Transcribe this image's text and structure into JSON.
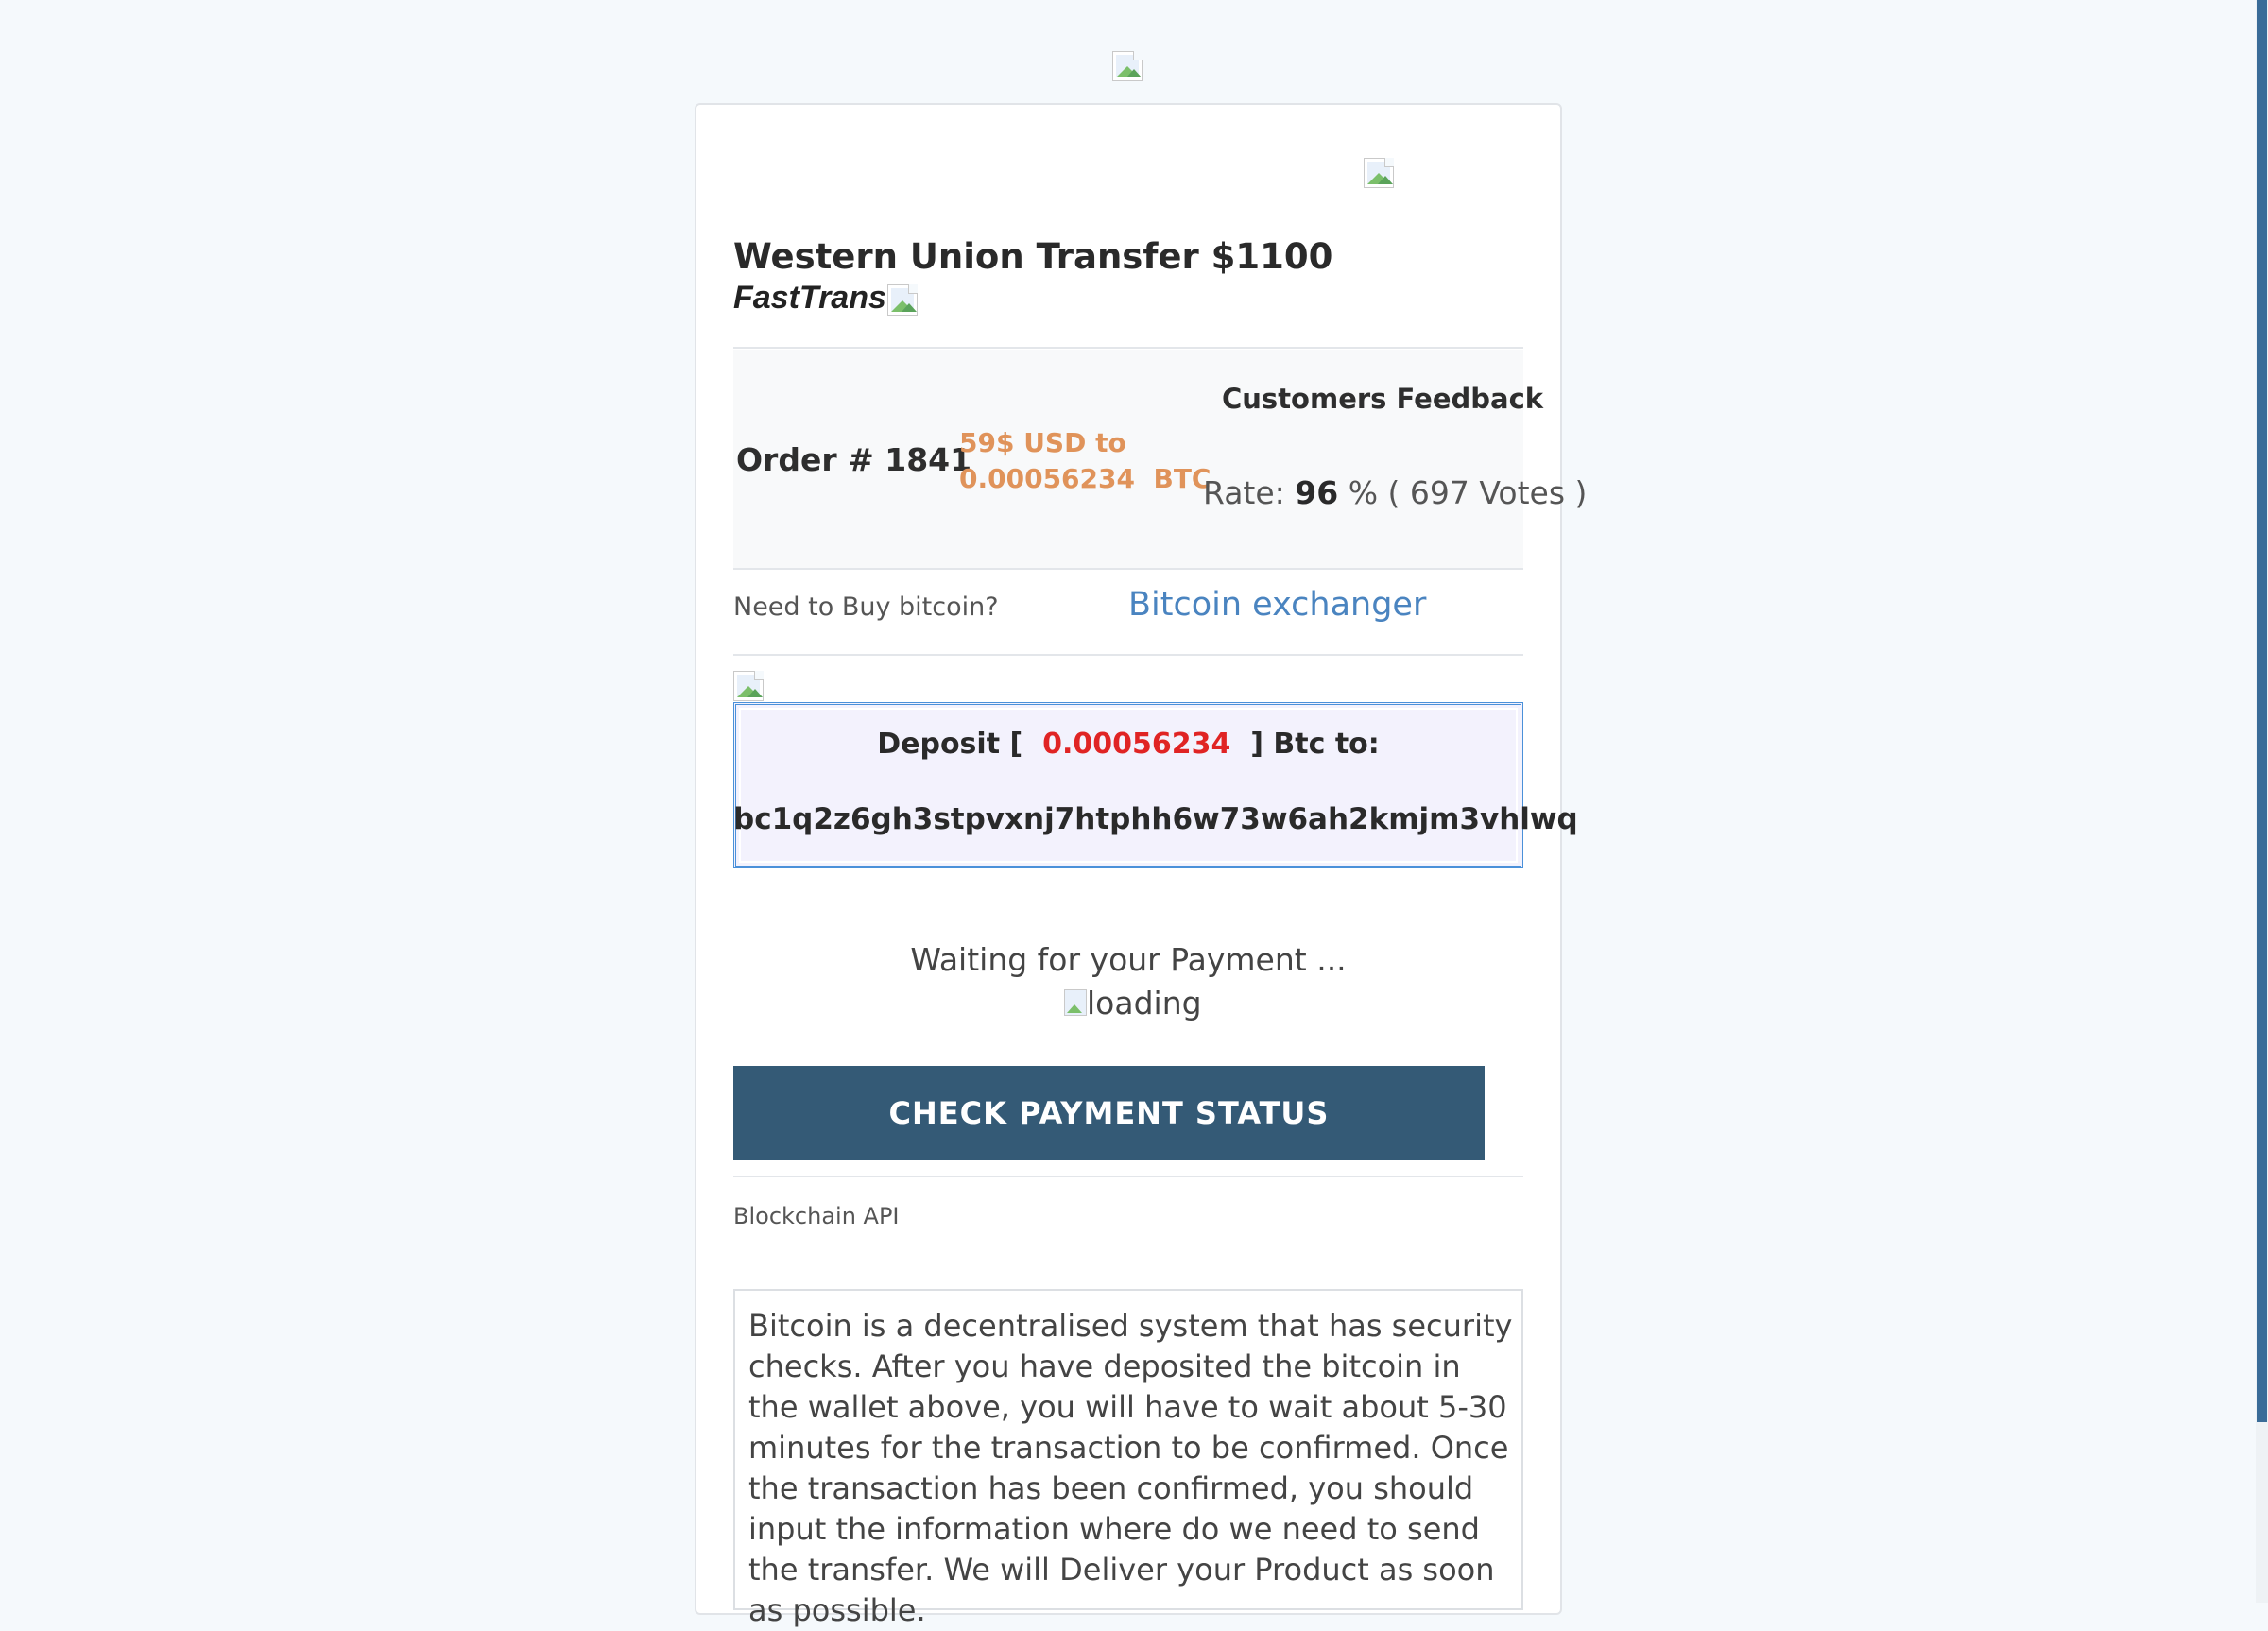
{
  "header": {
    "logo_icon": "broken-image-icon"
  },
  "product": {
    "title": "Western Union Transfer $1100",
    "brand": "FastTrans"
  },
  "order": {
    "number_label": "Order # 1841",
    "conversion_line1": "59$ USD to",
    "conversion_line2": "0.00056234  BTC"
  },
  "feedback": {
    "title": "Customers Feedback",
    "rate_prefix": "Rate: ",
    "rate_value": "96",
    "rate_suffix": " % ( 697 Votes )"
  },
  "buy": {
    "question": "Need to Buy bitcoin?",
    "link": "Bitcoin exchanger"
  },
  "deposit": {
    "prefix": "Deposit [  ",
    "amount": "0.00056234",
    "suffix": "  ] Btc to:",
    "address": "bc1q2z6gh3stpvxnj7htphh6w73w6ah2kmjm3vhlwq"
  },
  "status": {
    "waiting": "Waiting for your Payment ...",
    "loading_alt": "loading",
    "check_button": "CHECK PAYMENT STATUS",
    "api_label": "Blockchain API"
  },
  "info": {
    "text": "Bitcoin is a decentralised system that has security checks. After you have deposited the bitcoin in the wallet above, you will have to wait about 5-30 minutes for the transaction to be confirmed. Once the transaction has been confirmed, you should input the information where do we need to send the transfer. We will Deliver your Product as soon as possible."
  },
  "colors": {
    "button_bg": "#345a76",
    "conversion": "#e0935a",
    "deposit_amount": "#e02424",
    "link": "#4a84c0",
    "scrollbar_thumb": "#3a6c98"
  }
}
